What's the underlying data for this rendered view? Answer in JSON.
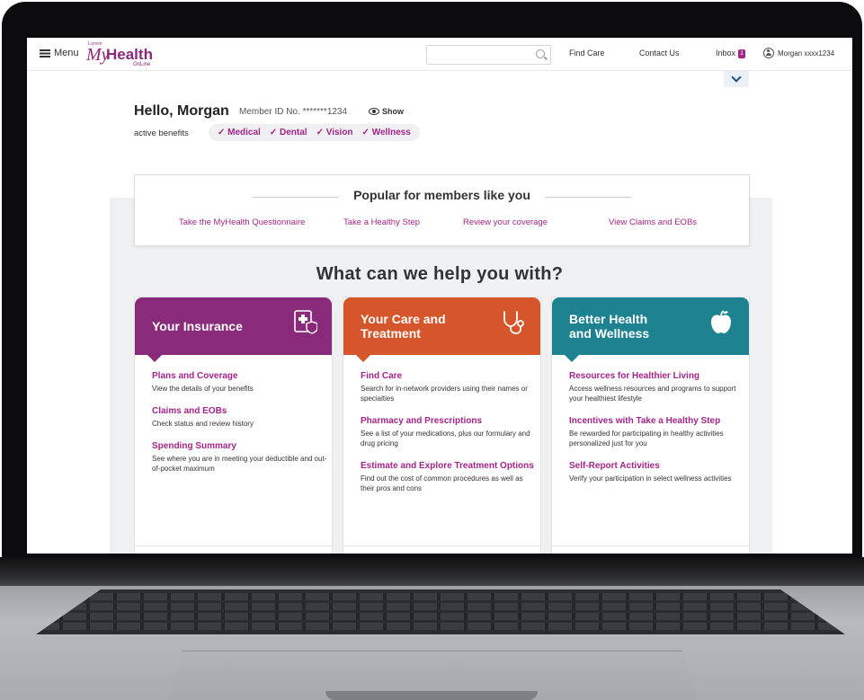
{
  "topbar": {
    "menu_label": "Menu",
    "logo_tag": "Lorem",
    "logo_my": "My",
    "logo_health": "Health",
    "logo_online": "OnLine",
    "search_placeholder": "",
    "find_care": "Find Care",
    "contact_us": "Contact Us",
    "inbox": "Inbox",
    "inbox_count": "1",
    "user_name": "Morgan xxxx1234"
  },
  "greeting": {
    "hello": "Hello, Morgan",
    "member_id": "Member ID No. *******1234",
    "show": "Show",
    "benefits_label": "active benefits",
    "benefits": [
      "✓ Medical",
      "✓ Dental",
      "✓ Vision",
      "✓ Wellness"
    ]
  },
  "popular": {
    "title": "Popular for members like you",
    "links": [
      "Take the MyHealth Questionnaire",
      "Take a Healthy Step",
      "Review your coverage",
      "View Claims and EOBs"
    ]
  },
  "help_title": "What can we help you with?",
  "cards": [
    {
      "title_line1": "Your Insurance",
      "title_line2": "",
      "color": "#8a2a7a",
      "accent": "#a3258a",
      "icon": "insurance-document-icon",
      "items": [
        {
          "title": "Plans and Coverage",
          "desc": "View the details of your benefits"
        },
        {
          "title": "Claims and EOBs",
          "desc": "Check status and review history"
        },
        {
          "title": "Spending Summary",
          "desc": "See where you are in meeting your deductible and out-of-pocket maximum"
        }
      ]
    },
    {
      "title_line1": "Your Care and",
      "title_line2": "Treatment",
      "color": "#d4562a",
      "accent": "#a3258a",
      "icon": "stethoscope-icon",
      "items": [
        {
          "title": "Find Care",
          "desc": "Search for in-network providers using their names or specialties"
        },
        {
          "title": "Pharmacy and Prescriptions",
          "desc": "See a list of your medications, plus our formulary and drug pricing"
        },
        {
          "title": "Estimate and Explore Treatment Options",
          "desc": "Find out the cost of common procedures as well as their pros and cons"
        }
      ]
    },
    {
      "title_line1": "Better Health",
      "title_line2": "and Wellness",
      "color": "#1e8291",
      "accent": "#a3258a",
      "icon": "apple-icon",
      "items": [
        {
          "title": "Resources for Healthier Living",
          "desc": "Access wellness resources and programs to support your healthiest lifestyle"
        },
        {
          "title": "Incentives with Take a Healthy Step",
          "desc": "Be rewarded for participating in healthy activities personalized just for you"
        },
        {
          "title": "Self-Report Activities",
          "desc": "Verify your participation in select wellness activities"
        }
      ]
    }
  ]
}
